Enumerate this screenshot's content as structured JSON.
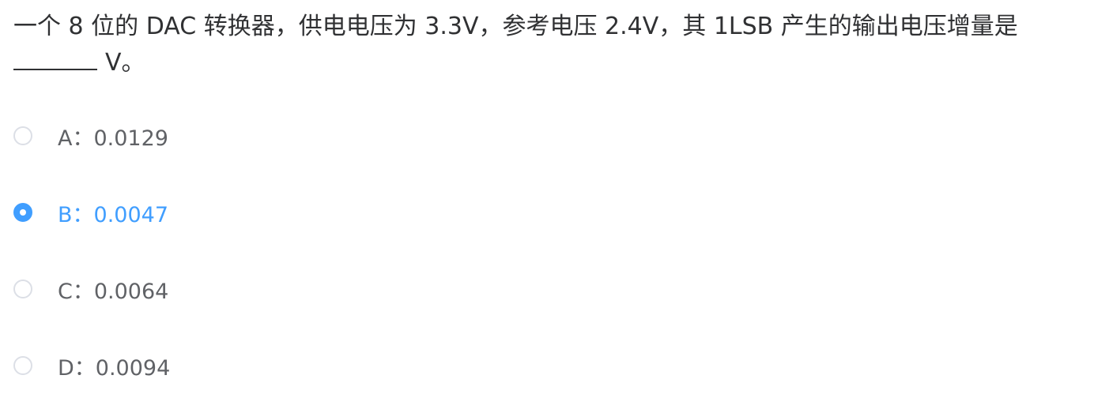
{
  "question": {
    "text_before_blank": "一个 8 位的 DAC 转换器，供电电压为 3.3V，参考电压 2.4V，其 1LSB 产生的输出电压增量是",
    "text_after_blank": "V。"
  },
  "options": [
    {
      "letter": "A",
      "sep": "：",
      "value": "0.0129",
      "selected": false
    },
    {
      "letter": "B",
      "sep": "：",
      "value": "0.0047",
      "selected": true
    },
    {
      "letter": "C",
      "sep": "：",
      "value": "0.0064",
      "selected": false
    },
    {
      "letter": "D",
      "sep": "：",
      "value": "0.0094",
      "selected": false
    }
  ],
  "colors": {
    "text": "#303133",
    "option_text": "#606266",
    "selected": "#409eff",
    "radio_border": "#dcdfe6"
  }
}
